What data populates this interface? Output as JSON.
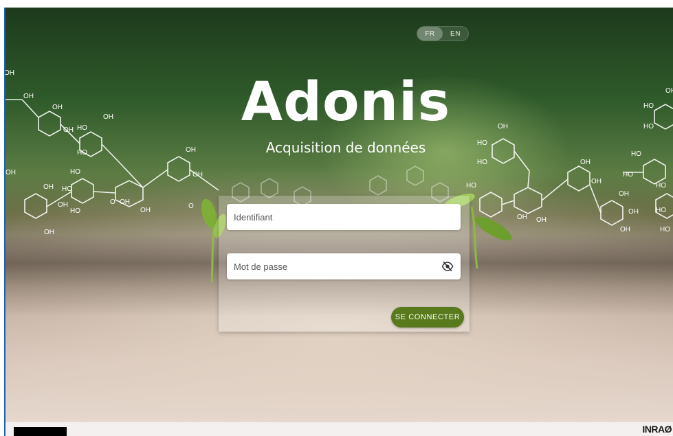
{
  "language": {
    "options": [
      "FR",
      "EN"
    ],
    "selected": "FR"
  },
  "brand": {
    "title": "Adonis",
    "subtitle": "Acquisition de données"
  },
  "login": {
    "username_placeholder": "Identifiant",
    "password_placeholder": "Mot de passe",
    "password_toggle_icon": "eye-off-icon",
    "submit_label": "SE CONNECTER"
  },
  "molecule_labels": [
    "OH",
    "HO",
    "O"
  ],
  "footer": {
    "right_logo": "INRAØ"
  },
  "colors": {
    "accent": "#587a1c",
    "text_light": "#ffffff"
  }
}
